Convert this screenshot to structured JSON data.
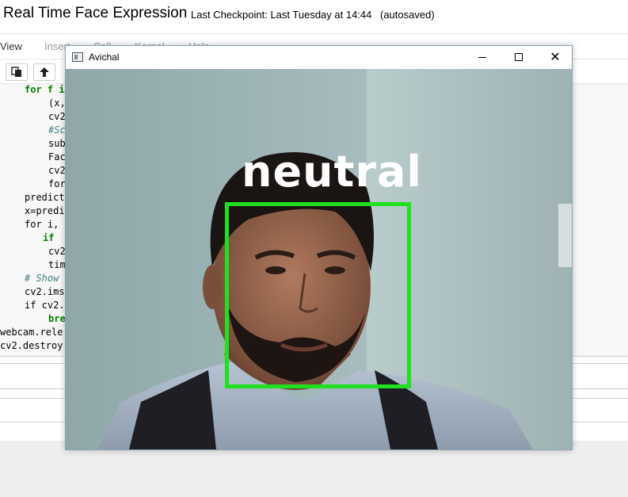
{
  "notebook": {
    "title": "Real Time Face Expression",
    "checkpoint": "Last Checkpoint: Last Tuesday at 14:44",
    "autosaved": "(autosaved)",
    "menu": [
      "View",
      "Insert",
      "Cell",
      "Kernel",
      "Help"
    ],
    "toolbar": {
      "copy_icon": "copy-icon",
      "up_icon": "arrow-up-icon"
    },
    "code_lines": [
      "for f i",
      "(x,",
      "cv2",
      "#Sc",
      "sub",
      "Fac",
      "cv2",
      "for",
      "predict",
      "x=predi",
      "for i,",
      "if",
      "cv2",
      "tim",
      "# Show",
      "cv2.ims",
      "if cv2.",
      "bre",
      "webcam.rele",
      "cv2.destroy"
    ]
  },
  "cv_window": {
    "title": "Avichal",
    "minimize_icon": "minimize-icon",
    "maximize_icon": "maximize-icon",
    "close_icon": "close-icon",
    "close_glyph": "✕",
    "expression_label": "neutral",
    "box_color": "#20e020",
    "label_color": "#ffffff"
  }
}
